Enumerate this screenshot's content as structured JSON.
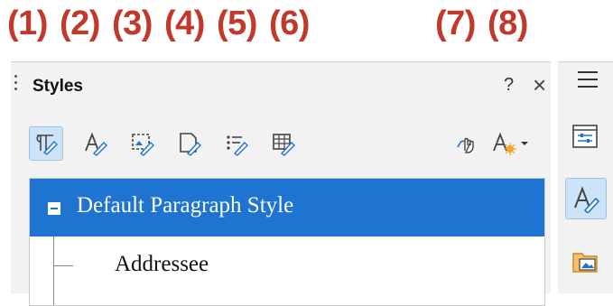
{
  "callouts": [
    "(1)",
    "(2)",
    "(3)",
    "(4)",
    "(5)",
    "(6)",
    "(7)",
    "(8)"
  ],
  "panel": {
    "title": "Styles",
    "help_label": "?",
    "close_label": "×"
  },
  "toolbar": {
    "buttons": [
      {
        "name": "paragraph-styles",
        "icon": "paragraph-styles-icon",
        "active": true
      },
      {
        "name": "character-styles",
        "icon": "character-styles-icon",
        "active": false
      },
      {
        "name": "frame-styles",
        "icon": "frame-styles-icon",
        "active": false
      },
      {
        "name": "page-styles",
        "icon": "page-styles-icon",
        "active": false
      },
      {
        "name": "list-styles",
        "icon": "list-styles-icon",
        "active": false
      },
      {
        "name": "table-styles",
        "icon": "table-styles-icon",
        "active": false
      },
      {
        "name": "fill-format-mode",
        "icon": "fill-format-icon",
        "active": false
      },
      {
        "name": "styles-actions",
        "icon": "new-style-icon",
        "active": false
      }
    ]
  },
  "styles_list": {
    "items": [
      {
        "label": "Default Paragraph Style",
        "selected": true,
        "expanded": true
      },
      {
        "label": "Addressee",
        "selected": false
      }
    ]
  },
  "sidebar": {
    "buttons": [
      {
        "name": "properties",
        "icon": "properties-icon",
        "active": false
      },
      {
        "name": "styles",
        "icon": "styles-icon",
        "active": true
      },
      {
        "name": "gallery",
        "icon": "gallery-icon",
        "active": false
      }
    ]
  },
  "colors": {
    "callout": "#c0392b",
    "selection": "#1e74d0",
    "active_button": "#cde3f7",
    "panel_bg": "#f2f2f2"
  }
}
